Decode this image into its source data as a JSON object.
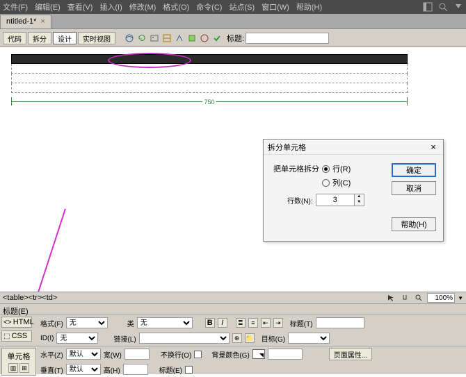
{
  "menubar": {
    "items": [
      "文件(F)",
      "编辑(E)",
      "查看(V)",
      "插入(I)",
      "修改(M)",
      "格式(O)",
      "命令(C)",
      "站点(S)",
      "窗口(W)",
      "帮助(H)"
    ]
  },
  "tab": {
    "name": "ntitled-1*",
    "close": "×"
  },
  "viewbar": {
    "btns": [
      "代码",
      "拆分",
      "设计",
      "实时视图"
    ],
    "title_label": "标题:",
    "title_value": ""
  },
  "table_width": "750",
  "dlg": {
    "title": "拆分单元格",
    "close": "×",
    "desc": "把单元格拆分",
    "row_radio": "行(R)",
    "col_radio": "列(C)",
    "rows_label": "行数(N):",
    "rows_value": "3",
    "ok": "确定",
    "cancel": "取消",
    "help": "帮助(H)"
  },
  "tagselector": {
    "tags": "<table><tr><td>",
    "zoom": "100%"
  },
  "props": {
    "header": "标题(E)",
    "mode_html": "HTML",
    "mode_css": "CSS",
    "fmt_label": "格式(F)",
    "fmt_value": "无",
    "id_label": "ID(I)",
    "id_value": "无",
    "class_label": "类",
    "class_value": "无",
    "link_label": "链接(L)",
    "link_value": "",
    "title_label": "标题(T)",
    "target_label": "目标(G)",
    "cell_label": "单元格",
    "hz_label": "水平(Z)",
    "hz_value": "默认",
    "vt_label": "垂直(T)",
    "vt_value": "默认",
    "w_label": "宽(W)",
    "h_label": "高(H)",
    "nowrap": "不换行(O)",
    "bg": "背景颜色(G)",
    "pageprops": "页面属性..."
  }
}
